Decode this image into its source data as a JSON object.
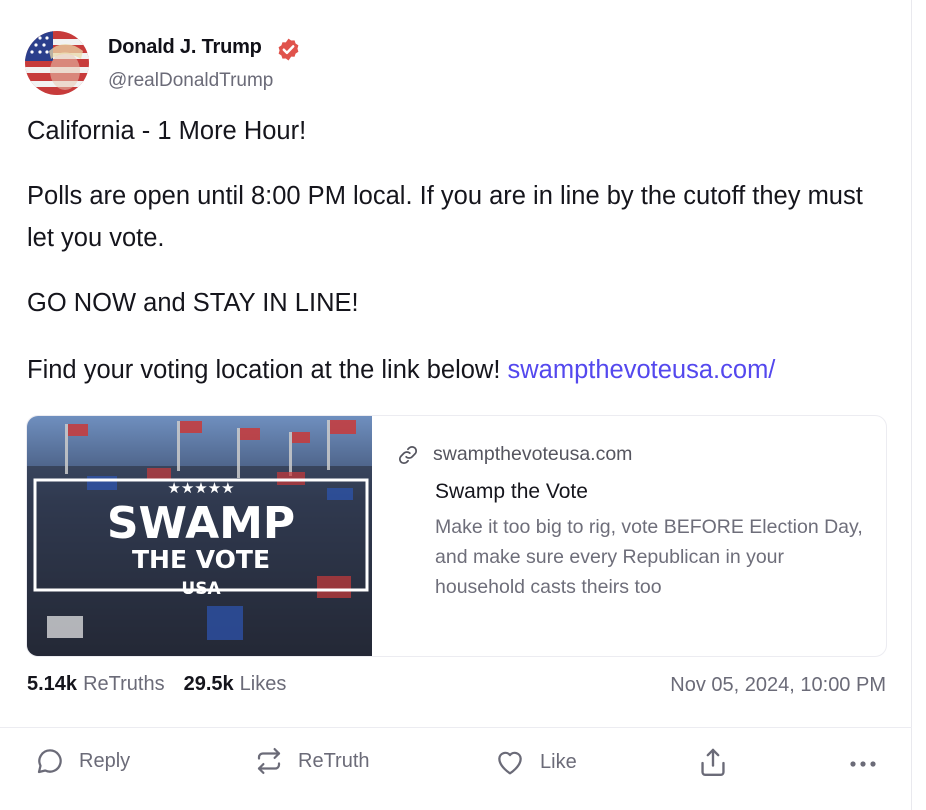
{
  "author": {
    "name": "Donald J. Trump",
    "handle": "@realDonaldTrump"
  },
  "post": {
    "line1": "California - 1 More Hour!",
    "line2": "Polls are open until 8:00 PM local. If you are in line by the cutoff they must let you vote.",
    "line3": "GO NOW and STAY IN LINE!",
    "line4_text": "Find your voting location at the link below! ",
    "line4_link": "swampthevoteusa.com/"
  },
  "link_card": {
    "image_text": {
      "stars": "★★★★★",
      "big": "SWAMP",
      "mid": "THE VOTE",
      "small": "USA"
    },
    "domain": "swampthevoteusa.com",
    "title": "Swamp the Vote",
    "description": "Make it too big to rig, vote BEFORE Election Day, and make sure every Republican in your household casts theirs too"
  },
  "stats": {
    "retruths_count": "5.14k",
    "retruths_label": "ReTruths",
    "likes_count": "29.5k",
    "likes_label": "Likes"
  },
  "timestamp": "Nov 05, 2024, 10:00 PM",
  "actions": {
    "reply": "Reply",
    "retruth": "ReTruth",
    "like": "Like"
  },
  "colors": {
    "link": "#5448ee",
    "verified": "#e0534c",
    "muted": "#6b6b78"
  },
  "icons": [
    "verified-badge-icon",
    "link-icon",
    "reply-icon",
    "retruth-icon",
    "like-icon",
    "share-icon",
    "more-icon"
  ]
}
